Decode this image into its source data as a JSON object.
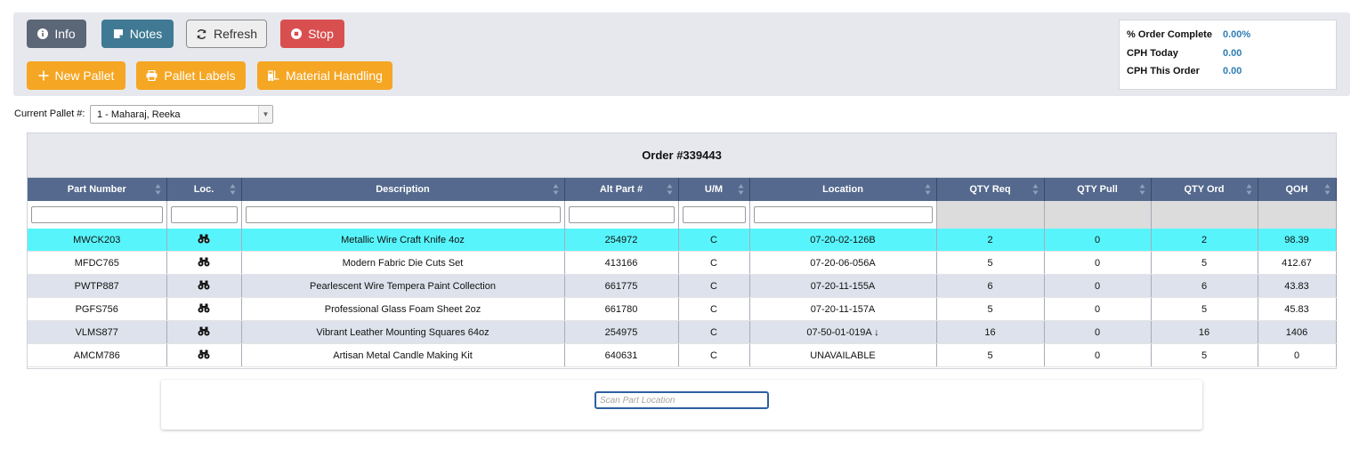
{
  "toolbar": {
    "info_label": "Info",
    "notes_label": "Notes",
    "refresh_label": "Refresh",
    "stop_label": "Stop",
    "new_pallet_label": "New Pallet",
    "pallet_labels_label": "Pallet Labels",
    "material_handling_label": "Material Handling"
  },
  "stats": {
    "order_complete_label": "% Order Complete",
    "order_complete_value": "0.00%",
    "cph_today_label": "CPH Today",
    "cph_today_value": "0.00",
    "cph_order_label": "CPH This Order",
    "cph_order_value": "0.00"
  },
  "pallet": {
    "label": "Current Pallet #:",
    "selected": "1 - Maharaj, Reeka"
  },
  "order": {
    "title": "Order #339443"
  },
  "columns": [
    "Part Number",
    "Loc.",
    "Description",
    "Alt Part #",
    "U/M",
    "Location",
    "QTY Req",
    "QTY Pull",
    "QTY Ord",
    "QOH"
  ],
  "rows": [
    {
      "part": "MWCK203",
      "desc": "Metallic Wire Craft Knife 4oz",
      "alt": "254972",
      "um": "C",
      "location": "07-20-02-126B",
      "req": "2",
      "pull": "0",
      "ord": "2",
      "qoh": "98.39"
    },
    {
      "part": "MFDC765",
      "desc": "Modern Fabric Die Cuts Set",
      "alt": "413166",
      "um": "C",
      "location": "07-20-06-056A",
      "req": "5",
      "pull": "0",
      "ord": "5",
      "qoh": "412.67"
    },
    {
      "part": "PWTP887",
      "desc": "Pearlescent Wire Tempera Paint Collection",
      "alt": "661775",
      "um": "C",
      "location": "07-20-11-155A",
      "req": "6",
      "pull": "0",
      "ord": "6",
      "qoh": "43.83"
    },
    {
      "part": "PGFS756",
      "desc": "Professional Glass Foam Sheet 2oz",
      "alt": "661780",
      "um": "C",
      "location": "07-20-11-157A",
      "req": "5",
      "pull": "0",
      "ord": "5",
      "qoh": "45.83"
    },
    {
      "part": "VLMS877",
      "desc": "Vibrant Leather Mounting Squares 64oz",
      "alt": "254975",
      "um": "C",
      "location": "07-50-01-019A ↓",
      "req": "16",
      "pull": "0",
      "ord": "16",
      "qoh": "1406"
    },
    {
      "part": "AMCM786",
      "desc": "Artisan Metal Candle Making Kit",
      "alt": "640631",
      "um": "C",
      "location": "UNAVAILABLE",
      "req": "5",
      "pull": "0",
      "ord": "5",
      "qoh": "0"
    }
  ],
  "scan": {
    "placeholder": "Scan Part Location"
  },
  "colors": {
    "highlight_row": "#57f5fb",
    "header_bg": "#54698d",
    "stat_value": "#2e7eb4",
    "orange": "#f5a623",
    "stop": "#d94f4f"
  }
}
